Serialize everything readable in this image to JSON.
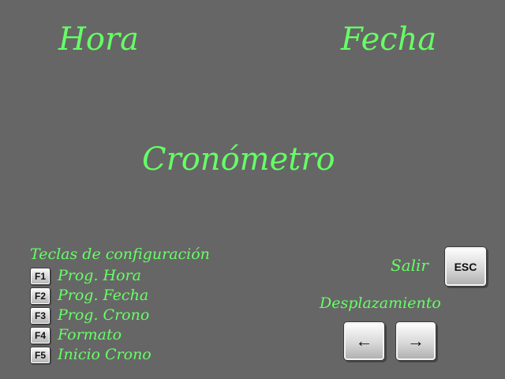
{
  "titles": {
    "hora": "Hora",
    "fecha": "Fecha",
    "cronometro": "Cronómetro"
  },
  "config": {
    "title": "Teclas de configuración",
    "keys": [
      {
        "key": "F1",
        "label": "Prog. Hora"
      },
      {
        "key": "F2",
        "label": "Prog. Fecha"
      },
      {
        "key": "F3",
        "label": "Prog. Crono"
      },
      {
        "key": "F4",
        "label": "Formato"
      },
      {
        "key": "F5",
        "label": "Inicio Crono"
      }
    ]
  },
  "exit": {
    "label": "Salir",
    "key": "ESC"
  },
  "navigation": {
    "label": "Desplazamiento",
    "left_key": "←",
    "right_key": "→"
  },
  "colors": {
    "background": "#666666",
    "text": "#66ff66"
  }
}
